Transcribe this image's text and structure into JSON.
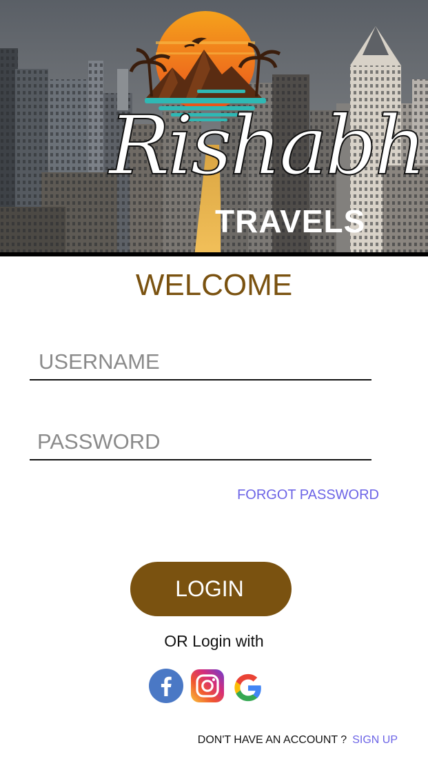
{
  "hero": {
    "brand_script": "Rishabh",
    "brand_sub": "TRAVELS"
  },
  "welcome": "WELCOME",
  "form": {
    "username_placeholder": "USERNAME",
    "password_placeholder": "PASSWORD",
    "forgot_label": "FORGOT PASSWORD",
    "login_label": "LOGIN"
  },
  "social": {
    "or_text": "OR Login with",
    "icons": [
      "facebook-icon",
      "instagram-icon",
      "google-icon"
    ]
  },
  "footer": {
    "question": "DON'T HAVE AN ACCOUNT ?",
    "signup_label": "SIGN UP"
  },
  "colors": {
    "brand_brown": "#7a5210",
    "link_purple": "#6b63e6",
    "facebook_blue": "#4a78c5"
  }
}
